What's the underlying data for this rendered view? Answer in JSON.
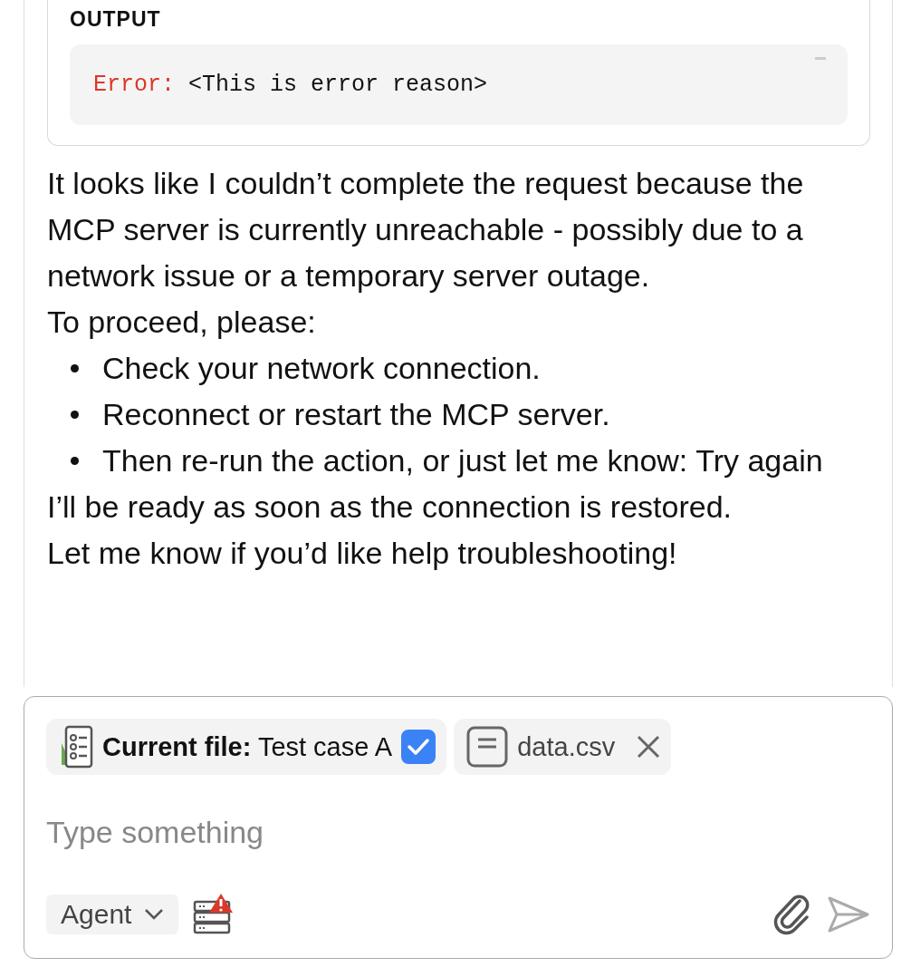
{
  "output": {
    "label": "OUTPUT",
    "error_prefix": "Error:",
    "error_text": "<This is error reason>"
  },
  "message": {
    "paragraphs": [
      "It looks like I couldn’t complete the request because the MCP server is currently unreachable - possibly due to a network issue or a temporary server outage.",
      "To proceed, please:"
    ],
    "bullets": [
      "Check your network connection.",
      "Reconnect or restart the MCP server.",
      "Then re-run the action, or just let me know: Try again"
    ],
    "closing": [
      "I’ll be ready as soon as the connection is restored.",
      "Let me know if you’d like help troubleshooting!"
    ]
  },
  "composer": {
    "chips": [
      {
        "kind": "current",
        "label": "Current file:",
        "name": "Test case A",
        "checked": true
      },
      {
        "kind": "file",
        "name": "data.csv"
      }
    ],
    "placeholder": "Type something",
    "mode": "Agent",
    "server_warning": true
  }
}
